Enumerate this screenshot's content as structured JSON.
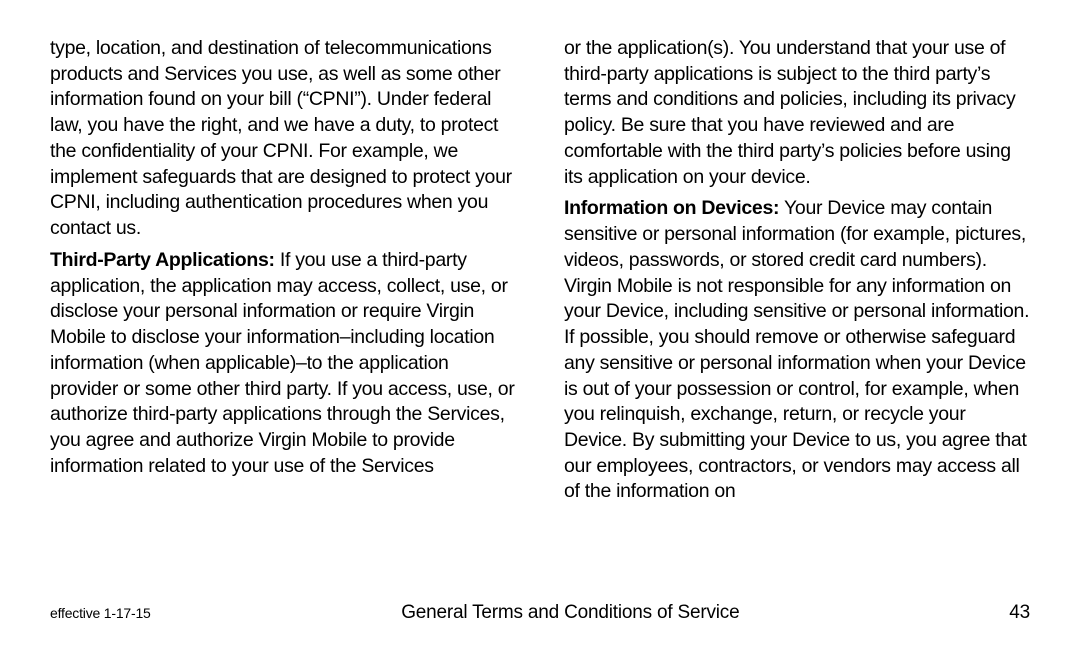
{
  "col1": {
    "p1": "type, location, and destination of telecommunications products and Services you use, as well as some other information found on your bill (“CPNI”). Under federal law, you have the right, and we have a duty, to protect the confidentiality of your CPNI. For example, we implement safeguards that are designed to protect your CPNI, including authentication procedures when you contact us.",
    "p2_head": "Third-Party Applications:",
    "p2_body": " If you use a third-party application, the application may access, collect, use, or disclose your personal information or require Virgin Mobile to disclose your information–including location information (when applicable)–to the application provider or some other third party. If you access, use, or authorize third-party applications through the Services, you agree and authorize Virgin Mobile to provide information related to your use of the Services"
  },
  "col2": {
    "p1": "or the application(s). You understand that your use of third-party applications is subject to the third party’s terms and conditions and policies, including its privacy policy. Be sure that you have reviewed and are comfortable with the third party’s policies before using its application on your device.",
    "p2_head": "Information on Devices:",
    "p2_body": " Your Device may contain sensitive or personal information (for example, pictures, videos, passwords, or stored credit card numbers). Virgin Mobile is not responsible for any information on your Device, including sensitive or personal information. If possible, you should remove or otherwise safeguard any sensitive or personal information when your Device is out of your possession or control, for example, when you relinquish, exchange, return, or recycle your Device. By submitting your Device to us, you agree that our employees, contractors, or vendors may access all of the information on"
  },
  "footer": {
    "left": "effective 1-17-15",
    "center": "General Terms and Conditions of Service",
    "page": "43"
  }
}
